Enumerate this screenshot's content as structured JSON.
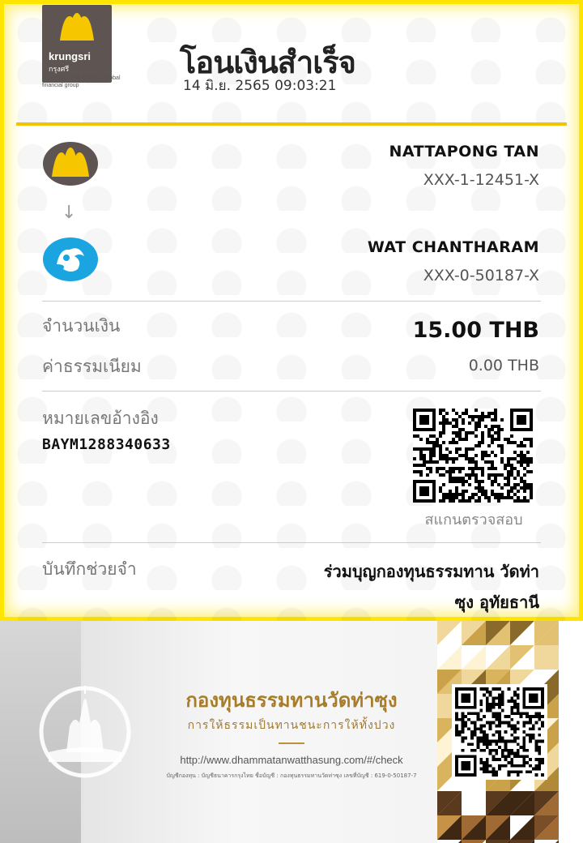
{
  "header": {
    "logo_word": "krungsri",
    "logo_thai": "กรุงศรี",
    "logo_tagline": "A member of ⊗ MUFG a global financial group",
    "title": "โอนเงินสำเร็จ",
    "datetime": "14 มิ.ย. 2565 09:03:21"
  },
  "sender": {
    "name": "NATTAPONG TAN",
    "account": "XXX-1-12451-X",
    "bank_icon": "krungsri-logo-icon"
  },
  "arrow": "↓",
  "receiver": {
    "name": "WAT CHANTHARAM",
    "account": "XXX-0-50187-X",
    "bank_icon": "ktb-bank-logo-icon"
  },
  "amount": {
    "label": "จำนวนเงิน",
    "value": "15.00 THB"
  },
  "fee": {
    "label": "ค่าธรรมเนียม",
    "value": "0.00 THB"
  },
  "reference": {
    "label": "หมายเลขอ้างอิง",
    "value": "BAYM1288340633",
    "scan_label": "สแกนตรวจสอบ"
  },
  "memo": {
    "label": "บันทึกช่วยจำ",
    "value_line1": "ร่วมบุญกองทุนธรรมทาน วัดท่า",
    "value_line2": "ซุง อุทัยธานี"
  },
  "banner": {
    "title": "กองทุนธรรมทานวัดท่าซุง",
    "subtitle": "การให้ธรรมเป็นทานชนะการให้ทั้งปวง",
    "url": "http://www.dhammatanwatthasung.com/#/check",
    "account_line": "บัญชีกองทุน : บัญชีธนาคารกรุงไทย ชื่อบัญชี : กองทุนธรรมทานวัดท่าซุง เลขที่บัญชี : 619-0-50187-7"
  },
  "colors": {
    "brand_yellow": "#f2c300",
    "krungsri_grey": "#5e5552",
    "ktb_blue": "#1ba5e0",
    "gold": "#a77d2a"
  }
}
